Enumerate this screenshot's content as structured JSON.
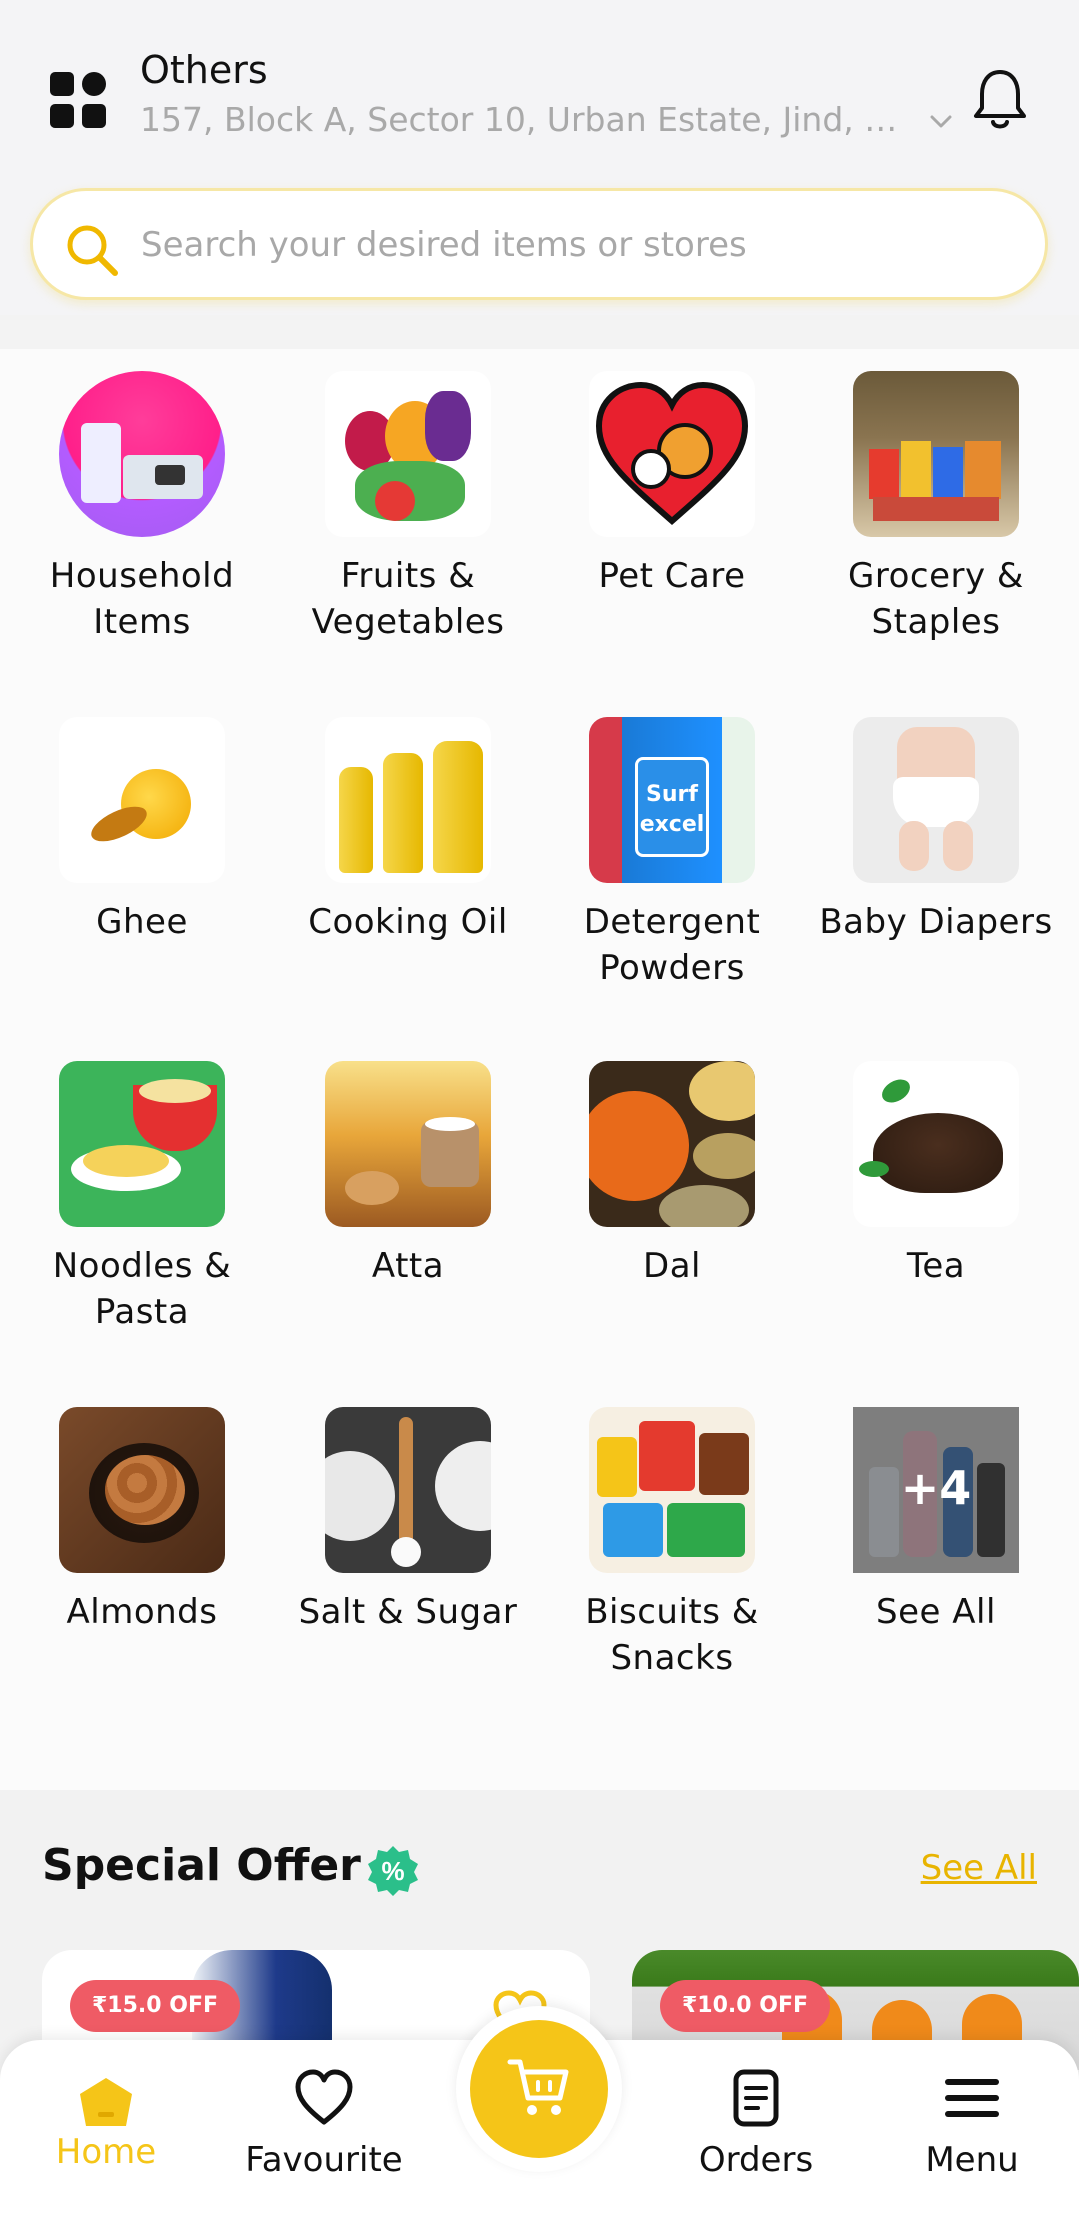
{
  "header": {
    "location_type": "Others",
    "address": "157, Block A, Sector 10, Urban Estate, Jind, Hary..."
  },
  "search": {
    "placeholder": "Search your desired items or stores"
  },
  "categories": [
    {
      "label": "Household Items"
    },
    {
      "label": "Fruits & Vegetables"
    },
    {
      "label": "Pet Care"
    },
    {
      "label": "Grocery & Staples"
    },
    {
      "label": "Ghee"
    },
    {
      "label": "Cooking Oil"
    },
    {
      "label": "Detergent Powders"
    },
    {
      "label": "Baby Diapers"
    },
    {
      "label": "Noodles & Pasta"
    },
    {
      "label": "Atta"
    },
    {
      "label": "Dal"
    },
    {
      "label": "Tea"
    },
    {
      "label": "Almonds"
    },
    {
      "label": "Salt & Sugar"
    },
    {
      "label": "Biscuits & Snacks"
    },
    {
      "label": "See All",
      "overlay": "+4"
    }
  ],
  "special_offer": {
    "title": "Special Offer",
    "see_all": "See All",
    "cards": [
      {
        "discount": "₹15.0 OFF"
      },
      {
        "discount": "₹10.0 OFF"
      }
    ]
  },
  "nav": {
    "home": "Home",
    "favourite": "Favourite",
    "orders": "Orders",
    "menu": "Menu"
  },
  "colors": {
    "accent": "#f5c518",
    "offer_badge": "#ef5b65",
    "discount_icon": "#2bbf8a"
  }
}
